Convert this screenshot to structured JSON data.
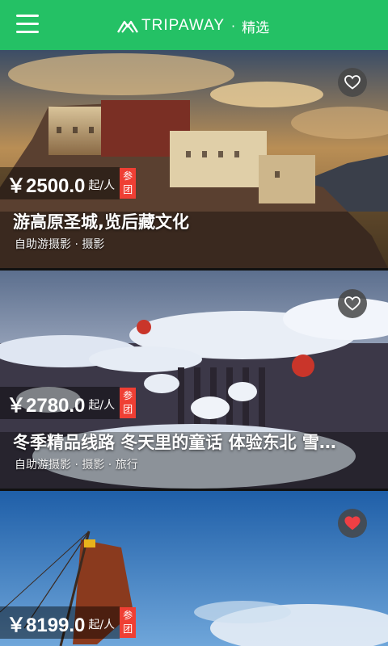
{
  "header": {
    "brand": "TRIPAWAY",
    "dot": "·",
    "section": "精选",
    "background": "#24c165"
  },
  "cards": [
    {
      "price": "￥2500.0",
      "unit": "起/人",
      "badge": [
        "参",
        "团"
      ],
      "title": "游高原圣城,览后藏文化",
      "tags": "自助游摄影 · 摄影",
      "favorited": false
    },
    {
      "price": "￥2780.0",
      "unit": "起/人",
      "badge": [
        "参",
        "团"
      ],
      "title": "冬季精品线路 冬天里的童话 体验东北 雪…",
      "tags": "自助游摄影 · 摄影 · 旅行",
      "favorited": false
    },
    {
      "price": "￥8199.0",
      "unit": "起/人",
      "badge": [
        "参",
        "团"
      ],
      "title": "",
      "tags": "",
      "favorited": true
    }
  ],
  "colors": {
    "accent": "#24c165",
    "badge": "#ef3f34",
    "heart_active": "#ef3f44"
  }
}
